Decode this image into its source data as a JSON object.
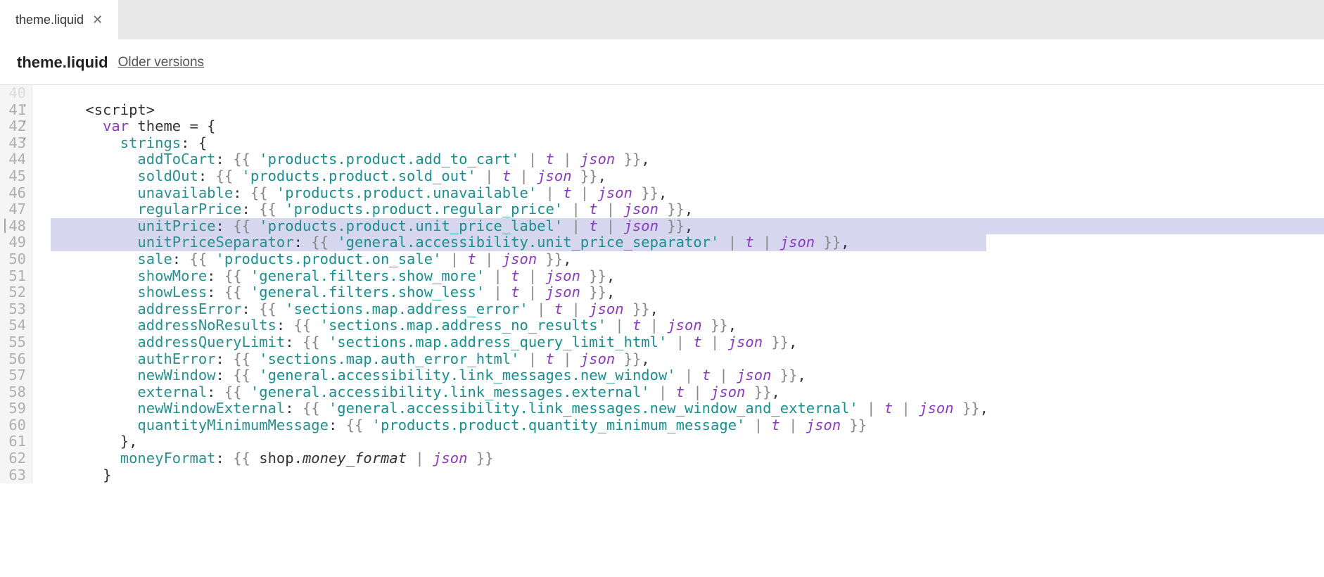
{
  "tab": {
    "name": "theme.liquid"
  },
  "header": {
    "title": "theme.liquid",
    "older": "Older versions"
  },
  "gutter": [
    {
      "n": "40",
      "fold": false,
      "break": false,
      "dim": true
    },
    {
      "n": "41",
      "fold": true,
      "break": false
    },
    {
      "n": "42",
      "fold": true,
      "break": false
    },
    {
      "n": "43",
      "fold": true,
      "break": false
    },
    {
      "n": "44",
      "fold": false,
      "break": false
    },
    {
      "n": "45",
      "fold": false,
      "break": false
    },
    {
      "n": "46",
      "fold": false,
      "break": false
    },
    {
      "n": "47",
      "fold": false,
      "break": false
    },
    {
      "n": "48",
      "fold": false,
      "break": true
    },
    {
      "n": "49",
      "fold": false,
      "break": false
    },
    {
      "n": "50",
      "fold": false,
      "break": false
    },
    {
      "n": "51",
      "fold": false,
      "break": false
    },
    {
      "n": "52",
      "fold": false,
      "break": false
    },
    {
      "n": "53",
      "fold": false,
      "break": false
    },
    {
      "n": "54",
      "fold": false,
      "break": false
    },
    {
      "n": "55",
      "fold": false,
      "break": false
    },
    {
      "n": "56",
      "fold": false,
      "break": false
    },
    {
      "n": "57",
      "fold": false,
      "break": false
    },
    {
      "n": "58",
      "fold": false,
      "break": false
    },
    {
      "n": "59",
      "fold": false,
      "break": false
    },
    {
      "n": "60",
      "fold": false,
      "break": false
    },
    {
      "n": "61",
      "fold": false,
      "break": false
    },
    {
      "n": "62",
      "fold": false,
      "break": false
    },
    {
      "n": "63",
      "fold": false,
      "break": false
    }
  ],
  "code": {
    "lines": [
      {
        "indent": 0,
        "tokens": []
      },
      {
        "indent": 4,
        "tokens": [
          [
            "tag",
            "<script>"
          ]
        ]
      },
      {
        "indent": 6,
        "tokens": [
          [
            "k",
            "var"
          ],
          [
            "obj",
            " theme "
          ],
          [
            "obj",
            "= {"
          ]
        ]
      },
      {
        "indent": 8,
        "tokens": [
          [
            "prop",
            "strings"
          ],
          [
            "obj",
            ": {"
          ]
        ]
      },
      {
        "indent": 10,
        "tokens": [
          [
            "prop",
            "addToCart"
          ],
          [
            "obj",
            ": "
          ],
          [
            "dlm",
            "{{ "
          ],
          [
            "str",
            "'products.product.add_to_cart'"
          ],
          [
            "pipe",
            " | "
          ],
          [
            "fil",
            "t"
          ],
          [
            "pipe",
            " | "
          ],
          [
            "fil",
            "json"
          ],
          [
            "dlm",
            " }}"
          ],
          [
            "obj",
            ","
          ]
        ]
      },
      {
        "indent": 10,
        "tokens": [
          [
            "prop",
            "soldOut"
          ],
          [
            "obj",
            ": "
          ],
          [
            "dlm",
            "{{ "
          ],
          [
            "str",
            "'products.product.sold_out'"
          ],
          [
            "pipe",
            " | "
          ],
          [
            "fil",
            "t"
          ],
          [
            "pipe",
            " | "
          ],
          [
            "fil",
            "json"
          ],
          [
            "dlm",
            " }}"
          ],
          [
            "obj",
            ","
          ]
        ]
      },
      {
        "indent": 10,
        "tokens": [
          [
            "prop",
            "unavailable"
          ],
          [
            "obj",
            ": "
          ],
          [
            "dlm",
            "{{ "
          ],
          [
            "str",
            "'products.product.unavailable'"
          ],
          [
            "pipe",
            " | "
          ],
          [
            "fil",
            "t"
          ],
          [
            "pipe",
            " | "
          ],
          [
            "fil",
            "json"
          ],
          [
            "dlm",
            " }}"
          ],
          [
            "obj",
            ","
          ]
        ]
      },
      {
        "indent": 10,
        "tokens": [
          [
            "prop",
            "regularPrice"
          ],
          [
            "obj",
            ": "
          ],
          [
            "dlm",
            "{{ "
          ],
          [
            "str",
            "'products.product.regular_price'"
          ],
          [
            "pipe",
            " | "
          ],
          [
            "fil",
            "t"
          ],
          [
            "pipe",
            " | "
          ],
          [
            "fil",
            "json"
          ],
          [
            "dlm",
            " }}"
          ],
          [
            "obj",
            ","
          ]
        ]
      },
      {
        "indent": 10,
        "hl": true,
        "tokens": [
          [
            "prop",
            "unitPrice"
          ],
          [
            "obj",
            ": "
          ],
          [
            "dlm",
            "{{ "
          ],
          [
            "str",
            "'products.product.unit_price_label'"
          ],
          [
            "pipe",
            " | "
          ],
          [
            "fil",
            "t"
          ],
          [
            "pipe",
            " | "
          ],
          [
            "fil",
            "json"
          ],
          [
            "dlm",
            " }}"
          ],
          [
            "obj",
            ","
          ]
        ]
      },
      {
        "indent": 10,
        "hl": true,
        "hlwidth": 1330,
        "tokens": [
          [
            "prop",
            "unitPriceSeparator"
          ],
          [
            "obj",
            ": "
          ],
          [
            "dlm",
            "{{ "
          ],
          [
            "str",
            "'general.accessibility.unit_price_separator'"
          ],
          [
            "pipe",
            " | "
          ],
          [
            "fil",
            "t"
          ],
          [
            "pipe",
            " | "
          ],
          [
            "fil",
            "json"
          ],
          [
            "dlm",
            " }}"
          ],
          [
            "obj",
            ","
          ]
        ]
      },
      {
        "indent": 10,
        "tokens": [
          [
            "prop",
            "sale"
          ],
          [
            "obj",
            ": "
          ],
          [
            "dlm",
            "{{ "
          ],
          [
            "str",
            "'products.product.on_sale'"
          ],
          [
            "pipe",
            " | "
          ],
          [
            "fil",
            "t"
          ],
          [
            "pipe",
            " | "
          ],
          [
            "fil",
            "json"
          ],
          [
            "dlm",
            " }}"
          ],
          [
            "obj",
            ","
          ]
        ]
      },
      {
        "indent": 10,
        "tokens": [
          [
            "prop",
            "showMore"
          ],
          [
            "obj",
            ": "
          ],
          [
            "dlm",
            "{{ "
          ],
          [
            "str",
            "'general.filters.show_more'"
          ],
          [
            "pipe",
            " | "
          ],
          [
            "fil",
            "t"
          ],
          [
            "pipe",
            " | "
          ],
          [
            "fil",
            "json"
          ],
          [
            "dlm",
            " }}"
          ],
          [
            "obj",
            ","
          ]
        ]
      },
      {
        "indent": 10,
        "tokens": [
          [
            "prop",
            "showLess"
          ],
          [
            "obj",
            ": "
          ],
          [
            "dlm",
            "{{ "
          ],
          [
            "str",
            "'general.filters.show_less'"
          ],
          [
            "pipe",
            " | "
          ],
          [
            "fil",
            "t"
          ],
          [
            "pipe",
            " | "
          ],
          [
            "fil",
            "json"
          ],
          [
            "dlm",
            " }}"
          ],
          [
            "obj",
            ","
          ]
        ]
      },
      {
        "indent": 10,
        "tokens": [
          [
            "prop",
            "addressError"
          ],
          [
            "obj",
            ": "
          ],
          [
            "dlm",
            "{{ "
          ],
          [
            "str",
            "'sections.map.address_error'"
          ],
          [
            "pipe",
            " | "
          ],
          [
            "fil",
            "t"
          ],
          [
            "pipe",
            " | "
          ],
          [
            "fil",
            "json"
          ],
          [
            "dlm",
            " }}"
          ],
          [
            "obj",
            ","
          ]
        ]
      },
      {
        "indent": 10,
        "tokens": [
          [
            "prop",
            "addressNoResults"
          ],
          [
            "obj",
            ": "
          ],
          [
            "dlm",
            "{{ "
          ],
          [
            "str",
            "'sections.map.address_no_results'"
          ],
          [
            "pipe",
            " | "
          ],
          [
            "fil",
            "t"
          ],
          [
            "pipe",
            " | "
          ],
          [
            "fil",
            "json"
          ],
          [
            "dlm",
            " }}"
          ],
          [
            "obj",
            ","
          ]
        ]
      },
      {
        "indent": 10,
        "tokens": [
          [
            "prop",
            "addressQueryLimit"
          ],
          [
            "obj",
            ": "
          ],
          [
            "dlm",
            "{{ "
          ],
          [
            "str",
            "'sections.map.address_query_limit_html'"
          ],
          [
            "pipe",
            " | "
          ],
          [
            "fil",
            "t"
          ],
          [
            "pipe",
            " | "
          ],
          [
            "fil",
            "json"
          ],
          [
            "dlm",
            " }}"
          ],
          [
            "obj",
            ","
          ]
        ]
      },
      {
        "indent": 10,
        "tokens": [
          [
            "prop",
            "authError"
          ],
          [
            "obj",
            ": "
          ],
          [
            "dlm",
            "{{ "
          ],
          [
            "str",
            "'sections.map.auth_error_html'"
          ],
          [
            "pipe",
            " | "
          ],
          [
            "fil",
            "t"
          ],
          [
            "pipe",
            " | "
          ],
          [
            "fil",
            "json"
          ],
          [
            "dlm",
            " }}"
          ],
          [
            "obj",
            ","
          ]
        ]
      },
      {
        "indent": 10,
        "tokens": [
          [
            "prop",
            "newWindow"
          ],
          [
            "obj",
            ": "
          ],
          [
            "dlm",
            "{{ "
          ],
          [
            "str",
            "'general.accessibility.link_messages.new_window'"
          ],
          [
            "pipe",
            " | "
          ],
          [
            "fil",
            "t"
          ],
          [
            "pipe",
            " | "
          ],
          [
            "fil",
            "json"
          ],
          [
            "dlm",
            " }}"
          ],
          [
            "obj",
            ","
          ]
        ]
      },
      {
        "indent": 10,
        "tokens": [
          [
            "prop",
            "external"
          ],
          [
            "obj",
            ": "
          ],
          [
            "dlm",
            "{{ "
          ],
          [
            "str",
            "'general.accessibility.link_messages.external'"
          ],
          [
            "pipe",
            " | "
          ],
          [
            "fil",
            "t"
          ],
          [
            "pipe",
            " | "
          ],
          [
            "fil",
            "json"
          ],
          [
            "dlm",
            " }}"
          ],
          [
            "obj",
            ","
          ]
        ]
      },
      {
        "indent": 10,
        "tokens": [
          [
            "prop",
            "newWindowExternal"
          ],
          [
            "obj",
            ": "
          ],
          [
            "dlm",
            "{{ "
          ],
          [
            "str",
            "'general.accessibility.link_messages.new_window_and_external'"
          ],
          [
            "pipe",
            " | "
          ],
          [
            "fil",
            "t"
          ],
          [
            "pipe",
            " | "
          ],
          [
            "fil",
            "json"
          ],
          [
            "dlm",
            " }}"
          ],
          [
            "obj",
            ","
          ]
        ]
      },
      {
        "indent": 10,
        "tokens": [
          [
            "prop",
            "quantityMinimumMessage"
          ],
          [
            "obj",
            ": "
          ],
          [
            "dlm",
            "{{ "
          ],
          [
            "str",
            "'products.product.quantity_minimum_message'"
          ],
          [
            "pipe",
            " | "
          ],
          [
            "fil",
            "t"
          ],
          [
            "pipe",
            " | "
          ],
          [
            "fil",
            "json"
          ],
          [
            "dlm",
            " }}"
          ]
        ]
      },
      {
        "indent": 8,
        "tokens": [
          [
            "obj",
            "},"
          ]
        ]
      },
      {
        "indent": 8,
        "tokens": [
          [
            "prop",
            "moneyFormat"
          ],
          [
            "obj",
            ": "
          ],
          [
            "dlm",
            "{{ "
          ],
          [
            "obj",
            "shop."
          ],
          [
            "mfi",
            "money_format"
          ],
          [
            "pipe",
            " | "
          ],
          [
            "fil",
            "json"
          ],
          [
            "dlm",
            " }}"
          ]
        ]
      },
      {
        "indent": 6,
        "tokens": [
          [
            "obj",
            "}"
          ]
        ]
      }
    ]
  }
}
